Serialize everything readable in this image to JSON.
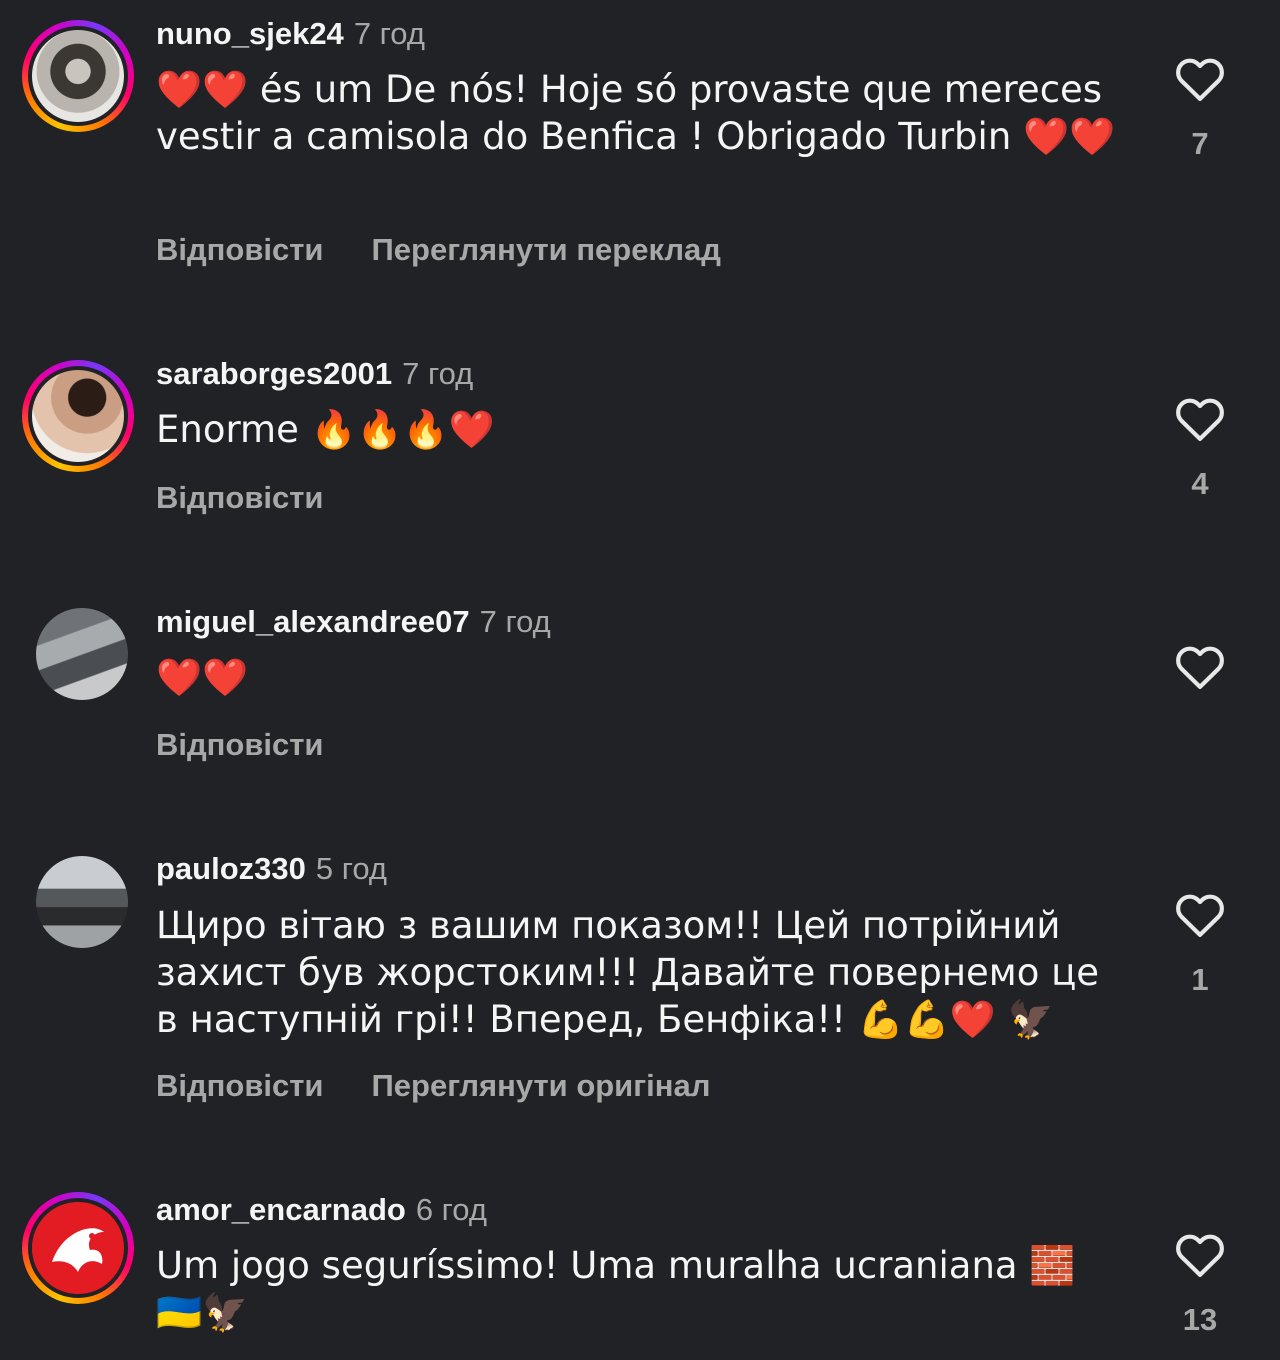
{
  "colors": {
    "background": "#202226",
    "text": "#f5f5f5",
    "muted": "#a8a8a8"
  },
  "comments": [
    {
      "username": "nuno_sjek24",
      "time": "7 год",
      "text": "❤️❤️ és um De nós!  Hoje só provaste que mereces vestir a camisola do Benfica ! Obrigado Turbin ❤️❤️",
      "reply": "Відповісти",
      "translate": "Переглянути переклад",
      "likes": "7",
      "story_ring": true
    },
    {
      "username": "saraborges2001",
      "time": "7 год",
      "text": "Enorme 🔥🔥🔥❤️",
      "reply": "Відповісти",
      "likes": "4",
      "story_ring": true
    },
    {
      "username": "miguel_alexandree07",
      "time": "7 год",
      "text": "❤️❤️",
      "reply": "Відповісти",
      "likes": "",
      "story_ring": false
    },
    {
      "username": "pauloz330",
      "time": "5 год",
      "text": "Щиро вітаю з вашим показом!! Цей потрійний захист був жорстоким!!! Давайте повернемо це в наступній грі!! Вперед, Бенфіка!! 💪💪❤️ 🦅",
      "reply": "Відповісти",
      "translate": "Переглянути оригінал",
      "likes": "1",
      "story_ring": false
    },
    {
      "username": "amor_encarnado",
      "time": "6 год",
      "text": "Um jogo seguríssimo! Uma muralha ucraniana 🧱🇺🇦🦅",
      "likes": "13",
      "story_ring": true
    }
  ]
}
